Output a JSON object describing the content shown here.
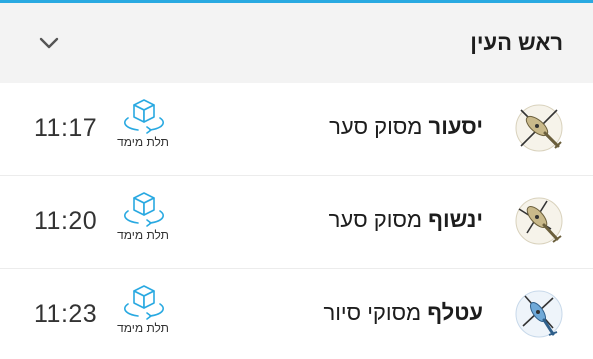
{
  "header": {
    "title": "ראש העין"
  },
  "rows": [
    {
      "place": "יסעור",
      "type": "מסוק סער",
      "view_label": "תלת מימד",
      "time": "11:17",
      "icon": "helicopter-icon"
    },
    {
      "place": "ינשוף",
      "type": "מסוק סער",
      "view_label": "תלת מימד",
      "time": "11:20",
      "icon": "helicopter-icon"
    },
    {
      "place": "עטלף",
      "type": "מסוקי סיור",
      "view_label": "תלת מימד",
      "time": "11:23",
      "icon": "helicopter-icon"
    }
  ],
  "colors": {
    "accent": "#29a9e1",
    "header_bg": "#f3f3f3",
    "aircraft_tan": "#c9b98a",
    "recon_blue": "#6fa9d8"
  }
}
